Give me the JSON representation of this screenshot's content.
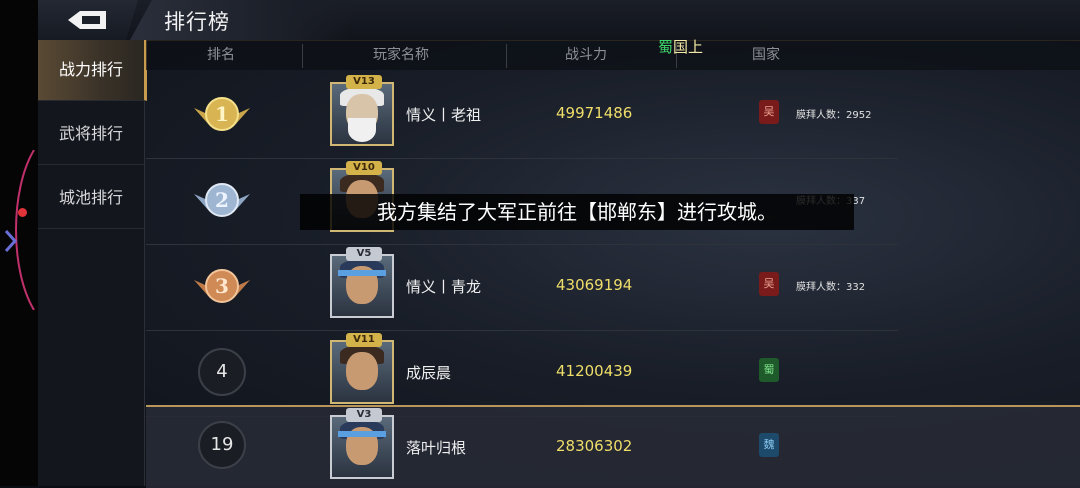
{
  "header": {
    "title": "排行榜"
  },
  "sidebar": {
    "items": [
      {
        "label": "战力排行"
      },
      {
        "label": "武将排行"
      },
      {
        "label": "城池排行"
      }
    ]
  },
  "columns": [
    "排名",
    "玩家名称",
    "战斗力",
    "国家"
  ],
  "banner": {
    "kingdom": "蜀",
    "text": "国上"
  },
  "rows": [
    {
      "rank": "1",
      "vip": "V13",
      "name": "情义丨老祖",
      "power": "49971486",
      "kingdom": "吴",
      "worship": "膜拜人数：2952"
    },
    {
      "rank": "2",
      "vip": "V10",
      "name": "",
      "power": "",
      "kingdom": "",
      "worship": "膜拜人数：337"
    },
    {
      "rank": "3",
      "vip": "V5",
      "name": "情义丨青龙",
      "power": "43069194",
      "kingdom": "吴",
      "worship": "膜拜人数：332"
    },
    {
      "rank": "4",
      "vip": "V11",
      "name": "成辰晨",
      "power": "41200439",
      "kingdom": "蜀",
      "worship": ""
    }
  ],
  "my_row": {
    "rank": "19",
    "vip": "V3",
    "name": "落叶归根",
    "power": "28306302",
    "kingdom": "魏"
  },
  "toast": "我方集结了大军正前往【邯郸东】进行攻城。"
}
